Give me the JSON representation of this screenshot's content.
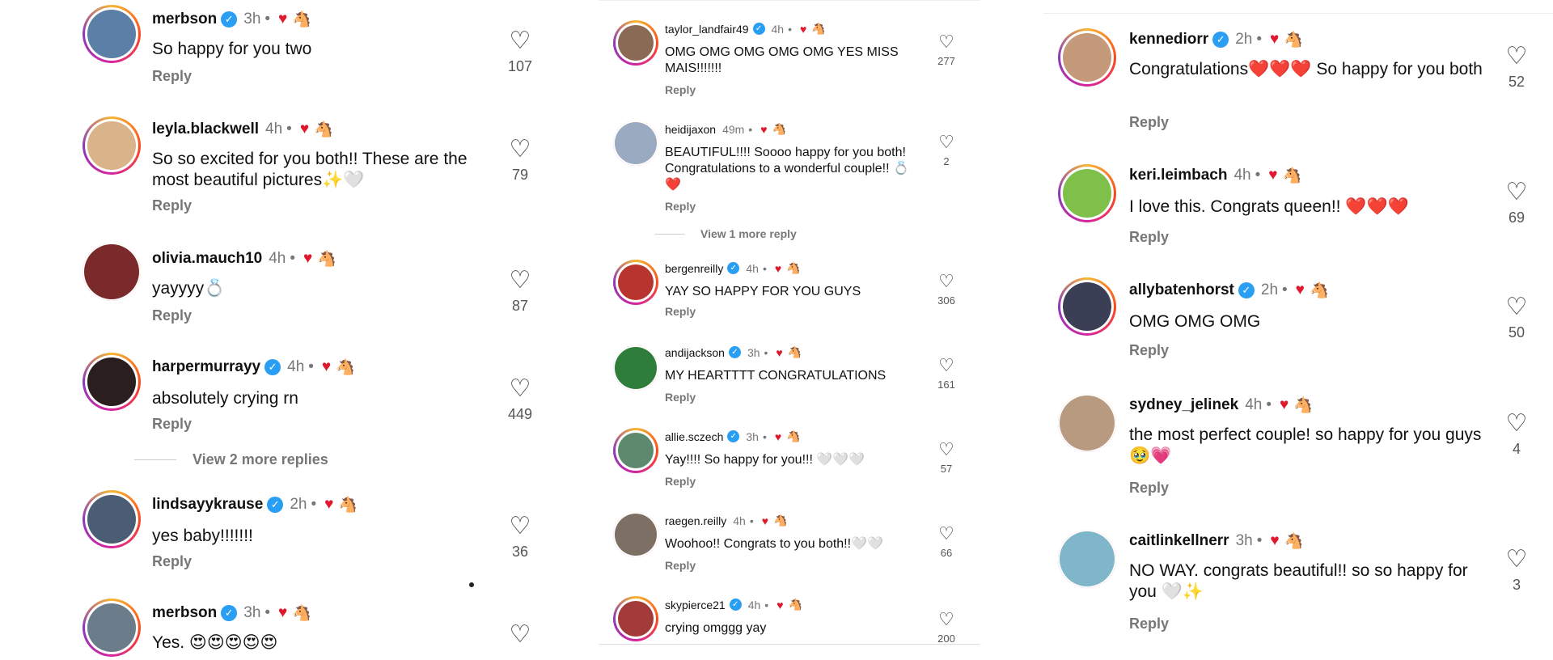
{
  "reply_label": "Reply",
  "icons": {
    "verified": "verified-badge-icon",
    "like": "heart-outline-icon",
    "creator_like": "red-heart-icon"
  },
  "columns": [
    {
      "comments": [
        {
          "username": "merbson",
          "verified": true,
          "time": "3h",
          "text": "So happy for you two",
          "likes": "107",
          "color": "#5b7fa6"
        },
        {
          "username": "leyla.blackwell",
          "verified": false,
          "time": "4h",
          "text": "So so excited for you both!! These are the most beautiful pictures✨🤍",
          "likes": "79",
          "color": "#d9b48a"
        },
        {
          "username": "olivia.mauch10",
          "verified": false,
          "time": "4h",
          "text": "yayyyy💍",
          "likes": "87",
          "color": "#7a2a2a"
        },
        {
          "username": "harpermurrayy",
          "verified": true,
          "time": "4h",
          "text": "absolutely crying rn",
          "likes": "449",
          "color": "#2a1e1e"
        },
        {
          "username": "lindsayykrause",
          "verified": true,
          "time": "2h",
          "text": "yes baby!!!!!!!",
          "likes": "36",
          "color": "#4a5d75"
        },
        {
          "username": "merbson",
          "verified": true,
          "time": "3h",
          "text": "Yes. 😍😍😍😍😍",
          "likes": "",
          "color": "#6b7c8a"
        }
      ],
      "more_replies": "View 2 more replies"
    },
    {
      "comments": [
        {
          "username": "taylor_landfair49",
          "verified": true,
          "time": "4h",
          "text": "OMG OMG OMG OMG OMG YES MISS MAIS!!!!!!!",
          "likes": "277",
          "color": "#8a6a55"
        },
        {
          "username": "heidijaxon",
          "verified": false,
          "time": "49m",
          "text": "BEAUTIFUL!!!! Soooo happy for you both! Congratulations to a wonderful couple!! 💍❤️",
          "likes": "2",
          "color": "#9aaac0"
        },
        {
          "username": "bergenreilly",
          "verified": true,
          "time": "4h",
          "text": "YAY SO HAPPY FOR YOU GUYS",
          "likes": "306",
          "color": "#b8342f"
        },
        {
          "username": "andijackson",
          "verified": true,
          "time": "3h",
          "text": "MY HEARTTTT CONGRATULATIONS",
          "likes": "161",
          "color": "#2f7d3a"
        },
        {
          "username": "allie.sczech",
          "verified": true,
          "time": "3h",
          "text": "Yay!!!! So happy for you!!! 🤍🤍🤍",
          "likes": "57",
          "color": "#5d8a6e"
        },
        {
          "username": "raegen.reilly",
          "verified": false,
          "time": "4h",
          "text": "Woohoo!! Congrats to you both!!🤍🤍",
          "likes": "66",
          "color": "#7d6f63"
        },
        {
          "username": "skypierce21",
          "verified": true,
          "time": "4h",
          "text": "crying omggg yay",
          "likes": "200",
          "color": "#a33a3a"
        }
      ],
      "more_replies": "View 1 more reply"
    },
    {
      "comments": [
        {
          "username": "kennediorr",
          "verified": true,
          "time": "2h",
          "text": "Congratulations❤️❤️❤️ So happy for you both",
          "likes": "52",
          "color": "#c49a7a"
        },
        {
          "username": "keri.leimbach",
          "verified": false,
          "time": "4h",
          "text": "I love this. Congrats queen!! ❤️❤️❤️",
          "likes": "69",
          "color": "#7ec04a"
        },
        {
          "username": "allybatenhorst",
          "verified": true,
          "time": "2h",
          "text": "OMG OMG OMG",
          "likes": "50",
          "color": "#3a3f55"
        },
        {
          "username": "sydney_jelinek",
          "verified": false,
          "time": "4h",
          "text": "the most perfect couple! so happy for you guys 🥹💗",
          "likes": "4",
          "color": "#b89a80"
        },
        {
          "username": "caitlinkellnerr",
          "verified": false,
          "time": "3h",
          "text": "NO WAY. congrats beautiful!! so so happy for you 🤍✨",
          "likes": "3",
          "color": "#7fb6c9"
        }
      ]
    }
  ]
}
